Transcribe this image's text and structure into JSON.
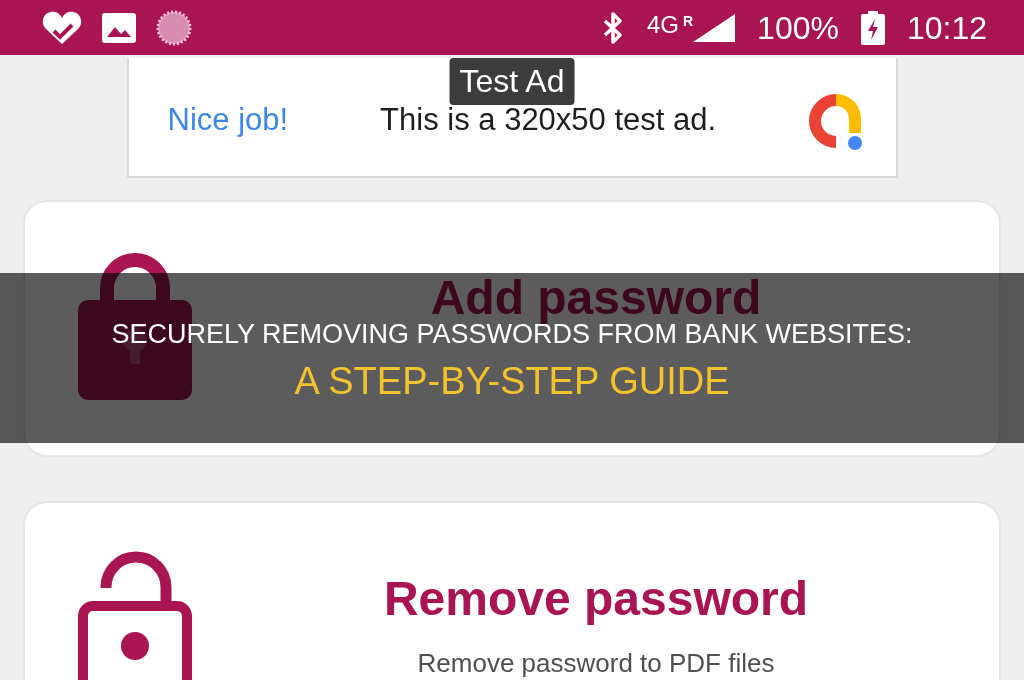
{
  "status_bar": {
    "network": "4G",
    "roaming": "R",
    "battery": "100%",
    "time": "10:12"
  },
  "ad": {
    "label": "Test Ad",
    "headline": "Nice job!",
    "body": "This is a 320x50 test ad."
  },
  "cards": [
    {
      "kind": "locked",
      "title": "Add password"
    },
    {
      "kind": "unlocked",
      "title": "Remove password",
      "subtitle": "Remove password to PDF files"
    }
  ],
  "banner": {
    "title": "SECURELY REMOVING PASSWORDS FROM BANK WEBSITES:",
    "subtitle": "A STEP-BY-STEP GUIDE"
  }
}
